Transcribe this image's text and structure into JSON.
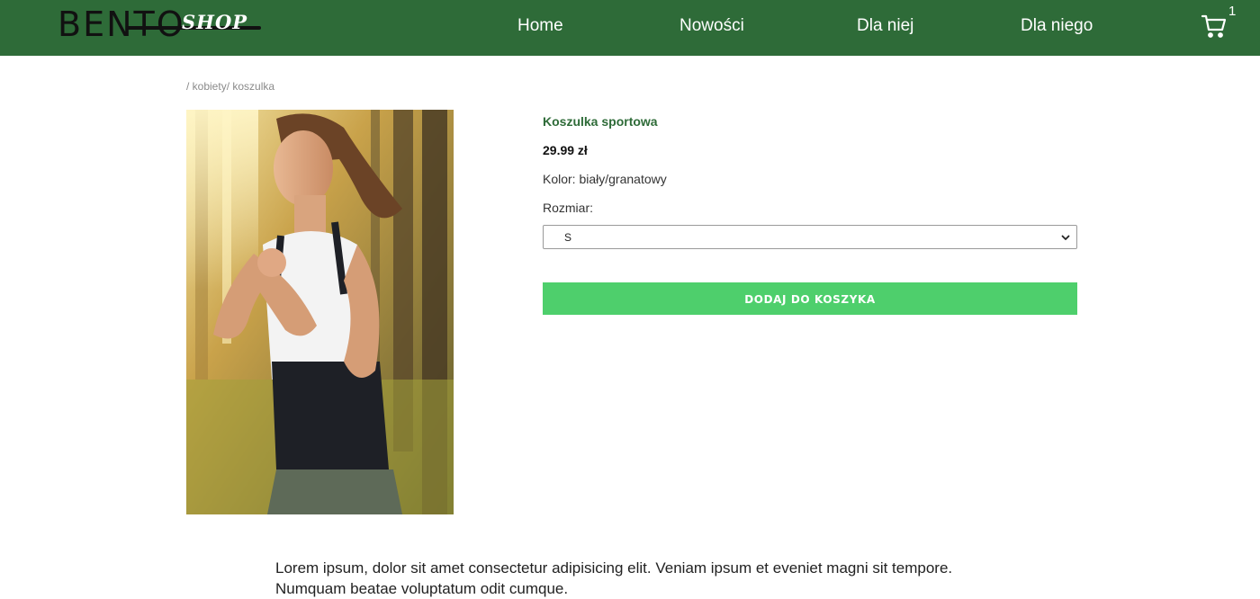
{
  "header": {
    "logo_main": "BENTO",
    "logo_sub": "SHOP",
    "nav": [
      "Home",
      "Nowości",
      "Dla niej",
      "Dla niego"
    ],
    "cart_count": "1",
    "color": "#2e6b38"
  },
  "breadcrumb": "/ kobiety/ koszulka",
  "product": {
    "title": "Koszulka sportowa",
    "price": "29.99 zł",
    "color_line": "Kolor: biały/granatowy",
    "size_label": "Rozmiar:",
    "size_selected": "S",
    "add_button": "DODAJ DO KOSZYKA",
    "button_color": "#4ecf6c",
    "image": "woman-running-photo"
  },
  "description": "Lorem ipsum, dolor sit amet consectetur adipisicing elit. Veniam ipsum et eveniet magni sit tempore. Numquam beatae voluptatum odit cumque."
}
